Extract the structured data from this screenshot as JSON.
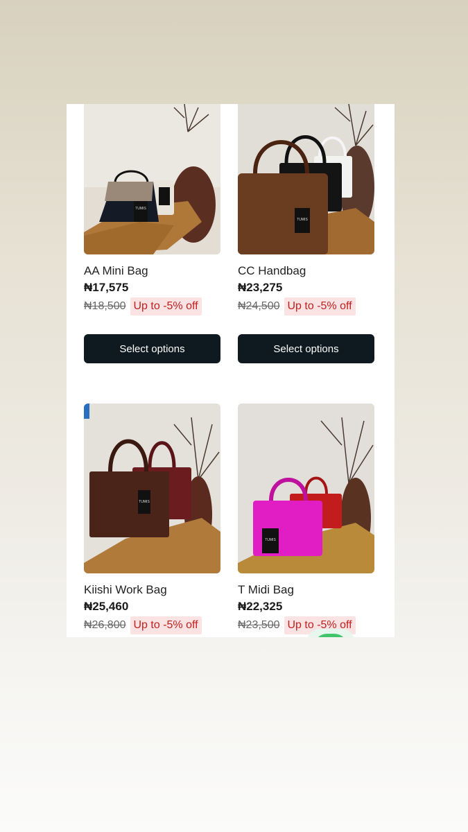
{
  "products": [
    {
      "name": "AA Mini Bag",
      "price": "₦17,575",
      "old_price": "₦18,500",
      "badge": "Up to -5% off",
      "button": "Select options"
    },
    {
      "name": "CC Handbag",
      "price": "₦23,275",
      "old_price": "₦24,500",
      "badge": "Up to -5% off",
      "button": "Select options"
    },
    {
      "name": "Kiishi Work Bag",
      "price": "₦25,460",
      "old_price": "₦26,800",
      "badge": "Up to -5% off"
    },
    {
      "name": "T Midi Bag",
      "price": "₦22,325",
      "old_price": "₦23,500",
      "badge": "Up to -5% off"
    }
  ],
  "colors": {
    "button_bg": "#0f1a20",
    "badge_bg": "#fbe3e3",
    "badge_text": "#c0201f",
    "whatsapp_green": "#2fbf5c"
  },
  "icons": {
    "floating_chat": "whatsapp-icon"
  }
}
